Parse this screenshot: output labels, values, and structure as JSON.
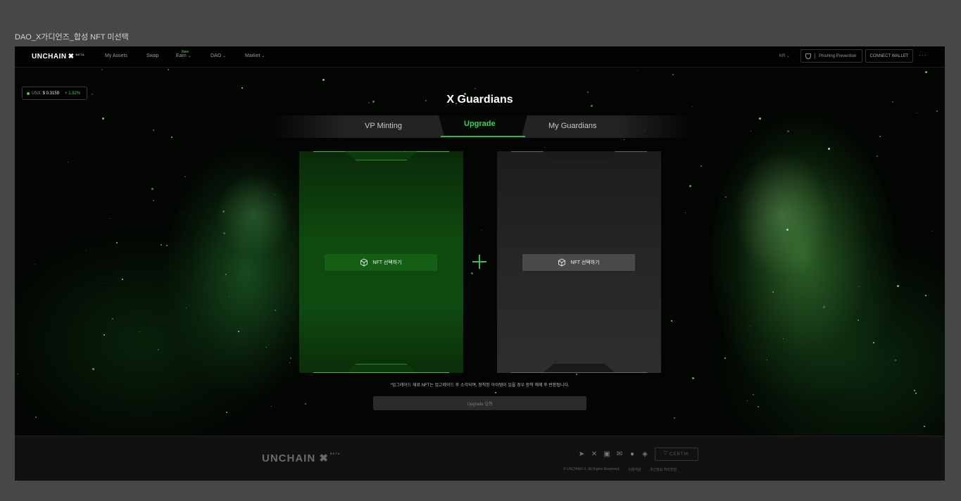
{
  "frame_label": "DAO_X가디언즈_합성 NFT 미선택",
  "nav": {
    "logo": "UNCHAIN",
    "logo_beta": "BETA",
    "items": [
      {
        "label": "My Assets",
        "has_chevron": false
      },
      {
        "label": "Swap",
        "has_chevron": false
      },
      {
        "label": "Earn",
        "has_chevron": true
      },
      {
        "label": "DAO",
        "has_chevron": true
      },
      {
        "label": "Market",
        "has_chevron": true
      }
    ],
    "new_badge": "New",
    "lang": "KR",
    "phishing": "Phishing Prevention",
    "connect": "CONNECT WALLET",
    "more": "···"
  },
  "price": {
    "token": "UNX",
    "value": "$ 0.3159",
    "change": "+ 1.92%",
    "accent": "#45d04e"
  },
  "page": {
    "title": "X Guardians"
  },
  "tabs": {
    "items": [
      "VP Minting",
      "Upgrade",
      "My Guardians"
    ],
    "active": "Upgrade",
    "accent": "#39d15a"
  },
  "cards": {
    "left_button": "NFT 선택하기",
    "right_button": "NFT 선택하기",
    "icon": "cube-icon"
  },
  "notice": "*업그레이드 재료 NFT는 업그레이드 후 소각되며, 장착된 아이템이 있을 경우 장착 해제 후 반환됩니다.",
  "upgrade_button": "Upgrade 실행",
  "footer": {
    "logo": "UNCHAIN",
    "logo_beta": "BETA",
    "socials": [
      "telegram-icon",
      "x-icon",
      "medium-icon",
      "mail-icon",
      "github-icon",
      "gitbook-icon"
    ],
    "certik": "CERTIK",
    "copyright": "© UNCHAIN X. All Rights Reserved.",
    "terms": "이용약관",
    "privacy": "개인정보 처리방침"
  }
}
